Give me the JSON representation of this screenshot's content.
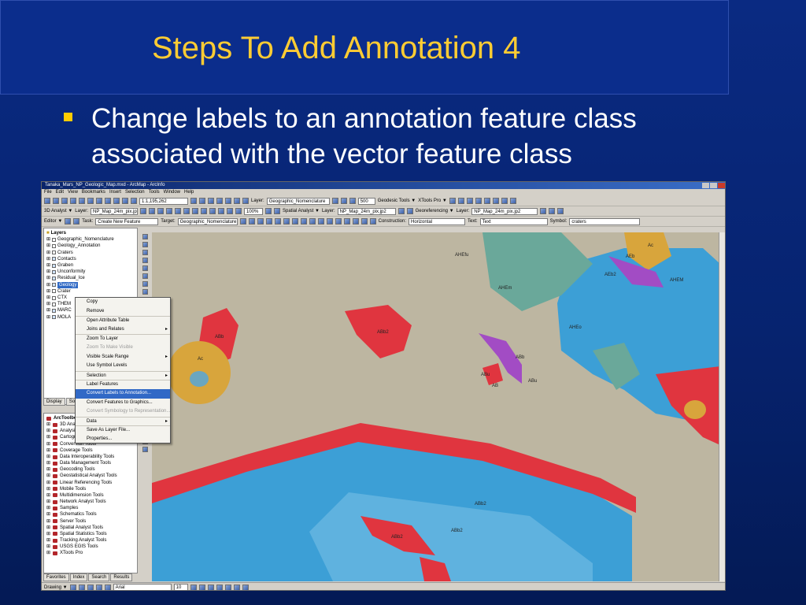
{
  "slide": {
    "title": "Steps To Add Annotation 4",
    "bullet": "Change labels to an annotation feature class associated with the vector feature class"
  },
  "app": {
    "window_title": "Tanaka_Mars_NP_Geologic_Map.mxd - ArcMap - ArcInfo",
    "menu": [
      "File",
      "Edit",
      "View",
      "Bookmarks",
      "Insert",
      "Selection",
      "Tools",
      "Window",
      "Help"
    ],
    "toolbar1": {
      "scale": "1:1,195,262",
      "layer_label": "Layer:",
      "layer_value": "Geographic_Nomenclature",
      "zoom_value": "500",
      "geodesic_tools": "Geodesic Tools ▼",
      "xtools_pro": "XTools Pro ▼"
    },
    "toolbar2": {
      "analyst": "3D Analyst ▼",
      "layer_label": "Layer:",
      "layer_value": "NP_Map_24m_pix.jp2",
      "zoom_pct": "100%",
      "spatial_analyst": "Spatial Analyst ▼",
      "layer2_label": "Layer:",
      "layer2_value": "NP_Map_24m_pix.jp2",
      "georeferencing": "Georeferencing ▼",
      "layer3_label": "Layer:",
      "layer3_value": "NP_Map_24m_pix.jp2"
    },
    "toolbar3": {
      "editor": "Editor ▼",
      "task_label": "Task:",
      "task_value": "Create New Feature",
      "target_label": "Target:",
      "target_value": "Geographic_Nomenclature",
      "construction_label": "Construction:",
      "construction_value": "Horizontal",
      "text_label": "Text:",
      "text_value": "Text",
      "symbol_label": "Symbol:",
      "symbol_value": "craters"
    },
    "toc": {
      "root": "Layers",
      "layers": [
        {
          "name": "Geographic_Nomenclature",
          "checked": false
        },
        {
          "name": "Geology_Annotation",
          "checked": false
        },
        {
          "name": "Craters",
          "checked": false
        },
        {
          "name": "Contacts",
          "checked": true
        },
        {
          "name": "Graben",
          "checked": true
        },
        {
          "name": "Unconformity",
          "checked": true
        },
        {
          "name": "Residual_Ice",
          "checked": true
        },
        {
          "name": "Geology",
          "checked": true,
          "selected": true
        },
        {
          "name": "Crater",
          "checked": false
        },
        {
          "name": "CTX",
          "checked": false
        },
        {
          "name": "THEM",
          "checked": false
        },
        {
          "name": "MARC",
          "checked": true
        },
        {
          "name": "MOLA",
          "checked": true
        }
      ],
      "tabs": [
        "Display",
        "Source"
      ]
    },
    "context_menu": [
      {
        "label": "Copy"
      },
      {
        "label": "Remove"
      },
      {
        "label": "Open Attribute Table",
        "sep": true
      },
      {
        "label": "Joins and Relates",
        "submenu": true
      },
      {
        "label": "Zoom To Layer",
        "sep": true
      },
      {
        "label": "Zoom To Make Visible",
        "disabled": true
      },
      {
        "label": "Visible Scale Range",
        "submenu": true
      },
      {
        "label": "Use Symbol Levels"
      },
      {
        "label": "Selection",
        "sep": true,
        "submenu": true
      },
      {
        "label": "Label Features",
        "sep": true
      },
      {
        "label": "Convert Labels to Annotation...",
        "highlight": true
      },
      {
        "label": "Convert Features to Graphics..."
      },
      {
        "label": "Convert Symbology to Representation...",
        "disabled": true
      },
      {
        "label": "Data",
        "sep": true,
        "submenu": true
      },
      {
        "label": "Save As Layer File...",
        "sep": true
      },
      {
        "label": "Properties..."
      }
    ],
    "toolbox": {
      "root": "ArcToolbox",
      "items": [
        "3D Analyst",
        "Analysis T",
        "Cartograp",
        "Conversion Tools",
        "Coverage Tools",
        "Data Interoperability Tools",
        "Data Management Tools",
        "Geocoding Tools",
        "Geostatistical Analyst Tools",
        "Linear Referencing Tools",
        "Mobile Tools",
        "Multidimension Tools",
        "Network Analyst Tools",
        "Samples",
        "Schematics Tools",
        "Server Tools",
        "Spatial Analyst Tools",
        "Spatial Statistics Tools",
        "Tracking Analyst Tools",
        "USGS EGIS Tools",
        "XTools Pro"
      ],
      "tabs": [
        "Favorites",
        "Index",
        "Search",
        "Results"
      ]
    },
    "map_labels": [
      {
        "text": "AHEfu"
      },
      {
        "text": "AHEm"
      },
      {
        "text": "AEb"
      },
      {
        "text": "Ac"
      },
      {
        "text": "AEb2"
      },
      {
        "text": "AHEM"
      },
      {
        "text": "AHEo"
      },
      {
        "text": "ABb2"
      },
      {
        "text": "ABb"
      },
      {
        "text": "ABb"
      },
      {
        "text": "ABu"
      },
      {
        "text": "ABu"
      },
      {
        "text": "AB"
      },
      {
        "text": "Ac"
      },
      {
        "text": "ABb2"
      },
      {
        "text": "ABb2"
      },
      {
        "text": "ABb2"
      }
    ],
    "draw_bar": {
      "drawing": "Drawing ▼",
      "font": "Arial",
      "size": "10"
    },
    "colors": {
      "red_unit": "#e0353f",
      "blue_unit": "#3c9fd6",
      "teal_unit": "#6aa89a",
      "purple_unit": "#a24cc4",
      "gold_unit": "#d8a53c",
      "terrain": "#bdb6a1"
    }
  }
}
